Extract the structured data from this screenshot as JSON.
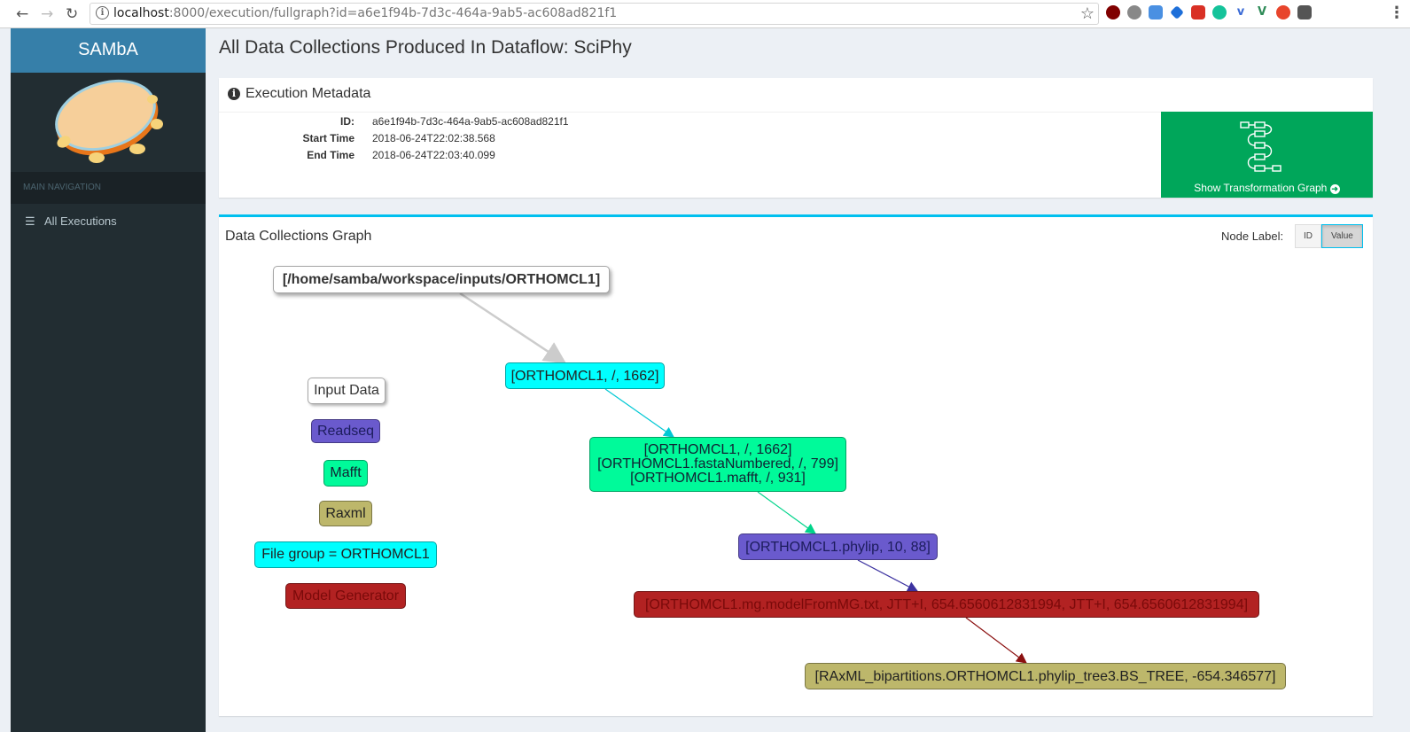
{
  "browser": {
    "url_host": "localhost",
    "url_path": ":8000/execution/fullgraph?id=a6e1f94b-7d3c-464a-9ab5-ac608ad821f1"
  },
  "sidebar": {
    "brand": "SAMbA",
    "nav_header": "MAIN NAVIGATION",
    "items": [
      {
        "label": "All Executions",
        "icon": "list-icon"
      }
    ]
  },
  "page": {
    "title": "All Data Collections Produced In Dataflow: SciPhy"
  },
  "metadata": {
    "header": "Execution Metadata",
    "id_label": "ID:",
    "id_value": "a6e1f94b-7d3c-464a-9ab5-ac608ad821f1",
    "start_label": "Start Time",
    "start_value": "2018-06-24T22:02:38.568",
    "end_label": "End Time",
    "end_value": "2018-06-24T22:03:40.099",
    "transform_button": "Show Transformation Graph"
  },
  "graph": {
    "title": "Data Collections Graph",
    "node_label_text": "Node Label:",
    "toggle": {
      "id": "ID",
      "value": "Value",
      "selected": "Value"
    },
    "legend": [
      {
        "label": "Input Data",
        "color": "#ffffff",
        "text_color": "#222222"
      },
      {
        "label": "Readseq",
        "color": "#6a5acd",
        "text_color": "#1c1c5c"
      },
      {
        "label": "Mafft",
        "color": "#00fa9a",
        "text_color": "#123"
      },
      {
        "label": "Raxml",
        "color": "#bdb76b",
        "text_color": "#222"
      },
      {
        "label": "File group = ORTHOMCL1",
        "color": "#00ffff",
        "text_color": "#222"
      },
      {
        "label": "Model Generator",
        "color": "#b22222",
        "text_color": "#7a0a0a"
      }
    ],
    "nodes": [
      {
        "lines": [
          "[/home/samba/workspace/inputs/ORTHOMCL1]"
        ],
        "color": "#ffffff"
      },
      {
        "lines": [
          "[ORTHOMCL1, /, 1662]"
        ],
        "color": "#00ffff"
      },
      {
        "lines": [
          "[ORTHOMCL1, /, 1662]",
          "[ORTHOMCL1.fastaNumbered, /, 799]",
          "[ORTHOMCL1.mafft, /, 931]"
        ],
        "color": "#00fa9a"
      },
      {
        "lines": [
          "[ORTHOMCL1.phylip, 10, 88]"
        ],
        "color": "#6a5acd"
      },
      {
        "lines": [
          "[ORTHOMCL1.mg.modelFromMG.txt, JTT+I, 654.6560612831994, JTT+I, 654.6560612831994]"
        ],
        "color": "#b22222"
      },
      {
        "lines": [
          "[RAxML_bipartitions.ORTHOMCL1.phylip_tree3.BS_TREE, -654.346577]"
        ],
        "color": "#bdb76b"
      }
    ],
    "edge_colors": [
      "#cccccc",
      "#00c8d4",
      "#00d48a",
      "#3c32a0",
      "#8b1010"
    ]
  }
}
